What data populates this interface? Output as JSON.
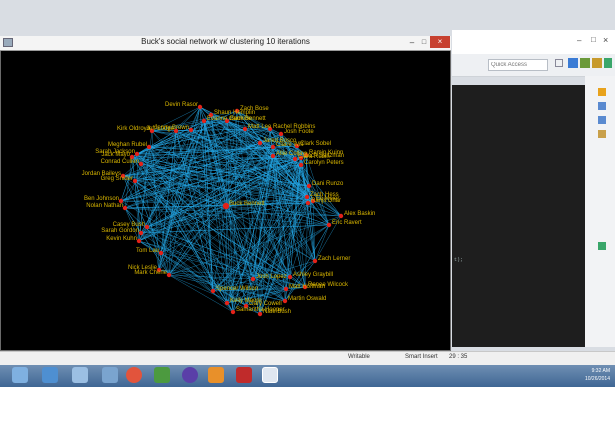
{
  "window": {
    "title": "Buck's social network w/ clustering 10 iterations",
    "min_glyph": "–",
    "max_glyph": "□",
    "close_glyph": "×"
  },
  "eclipse": {
    "quick_access_placeholder": "Quick Access",
    "status_writable": "Writable",
    "status_insert": "Smart Insert",
    "status_position": "29 : 35",
    "editor_text": "t);"
  },
  "taskbar": {
    "time": "9:32 AM",
    "date": "10/26/2014"
  },
  "graph": {
    "nodes": [
      {
        "label": "Devin Rasor"
      },
      {
        "label": "Zach Bose"
      },
      {
        "label": "Shaun Hemplin"
      },
      {
        "label": "Buck Bennett"
      },
      {
        "label": "Evanne Carmine"
      },
      {
        "label": "Matt Lee"
      },
      {
        "label": "Rachel Robbins"
      },
      {
        "label": "Josh Foote"
      },
      {
        "label": "Jared Bosco"
      },
      {
        "label": "Clark Sobel"
      },
      {
        "label": "Claire Wilt"
      },
      {
        "label": "Ramin Kuinn"
      },
      {
        "label": "Allie Collins"
      },
      {
        "label": "Clara Rubin"
      },
      {
        "label": "Kirk Oldroyd"
      },
      {
        "label": "Jeff Lodge"
      },
      {
        "label": "Sarah Jackson"
      },
      {
        "label": "Jack Mayo"
      },
      {
        "label": "Conrad Cullen"
      },
      {
        "label": "Zach Saltzman"
      },
      {
        "label": "Carolyn Peters"
      },
      {
        "label": "Dani Runzo"
      },
      {
        "label": "Zach Hess"
      },
      {
        "label": "Ranjit Dhar"
      },
      {
        "label": "Eli Meier"
      },
      {
        "label": "Alex Baskin"
      },
      {
        "label": "Eric Ravert"
      },
      {
        "label": "Zach Lerner"
      },
      {
        "label": "Ashley Graybill"
      },
      {
        "label": "Renee Wilcock"
      },
      {
        "label": "Matt Hoffman"
      },
      {
        "label": "Martin Oswald"
      },
      {
        "label": "Nate Bush"
      },
      {
        "label": "Samantha Hooper"
      },
      {
        "label": "Gary Cowell"
      },
      {
        "label": "Kelly Moore"
      },
      {
        "label": "Spencer Wilson"
      },
      {
        "label": "Mark Cherie"
      },
      {
        "label": "Nick Leslie"
      },
      {
        "label": "Kevin Kuhn"
      },
      {
        "label": "Sarah Gordon"
      },
      {
        "label": "Ben Johnson"
      },
      {
        "label": "Nolan Nathan"
      },
      {
        "label": "Jordan Baileys"
      },
      {
        "label": "Meghan Rubel"
      },
      {
        "label": "Jenny Brown"
      },
      {
        "label": "Tom Lau"
      },
      {
        "label": "Casey Bush"
      },
      {
        "label": "Greg Snider"
      },
      {
        "label": "Josh Lopez"
      },
      {
        "label": "Buck Bennett"
      }
    ],
    "hub_label": "Buck Bennett",
    "edge_color": "#24a8e8",
    "node_color": "#e32219",
    "label_color": "#d9b600",
    "background": "#000000"
  }
}
